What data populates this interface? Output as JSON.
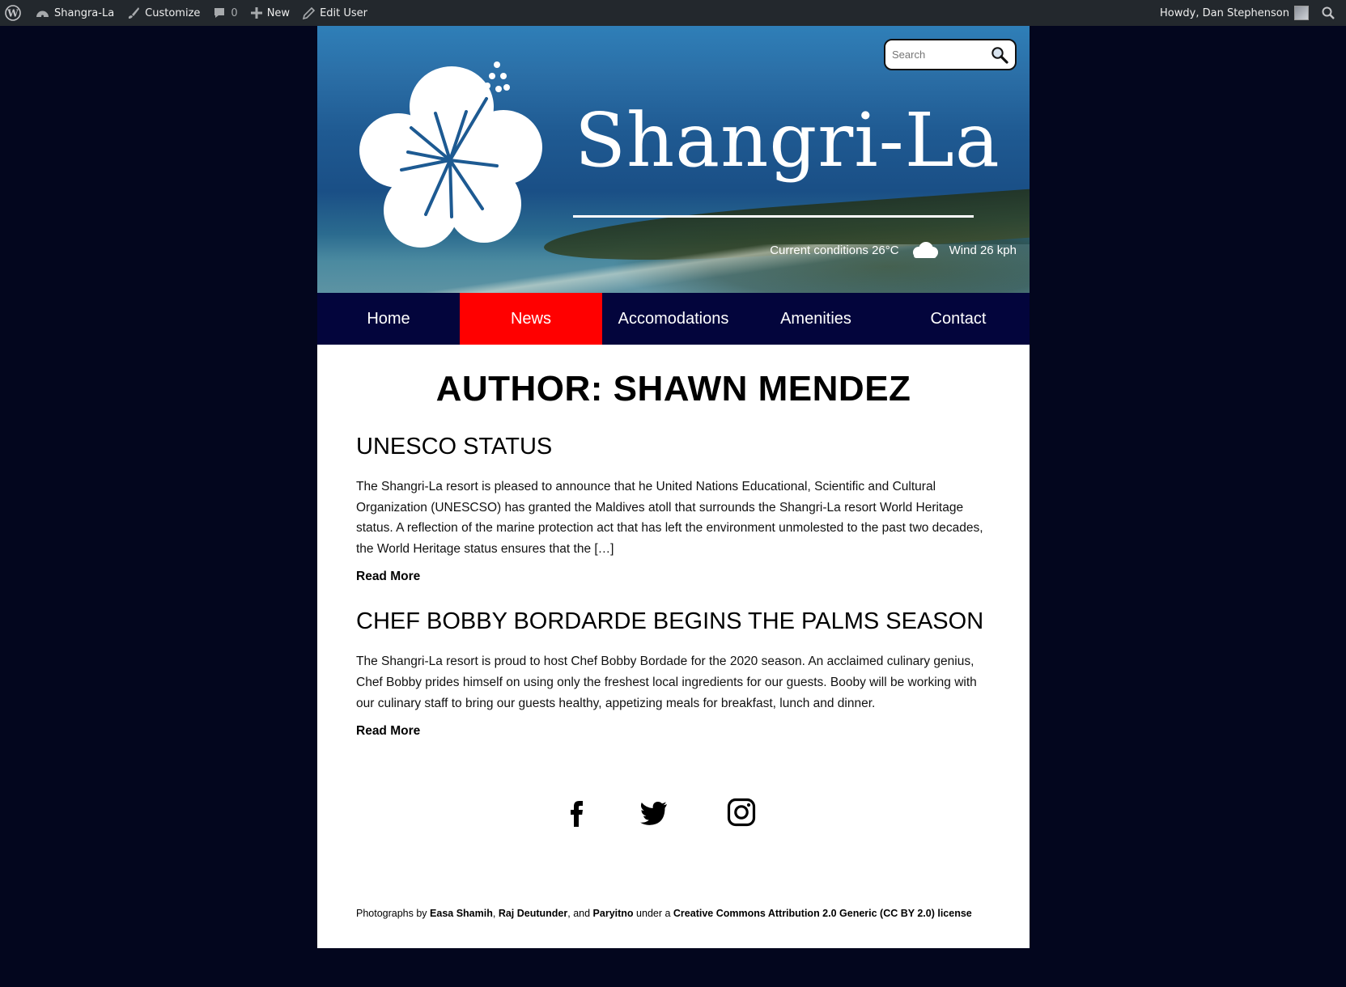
{
  "admin_bar": {
    "site_name": "Shangra-La",
    "customize": "Customize",
    "comments_count": "0",
    "new_label": "New",
    "edit_user": "Edit User",
    "howdy": "Howdy, Dan Stephenson"
  },
  "header": {
    "search_placeholder": "Search",
    "site_title": "Shangri-La",
    "conditions": "Current conditions 26°C",
    "wind": "Wind 26 kph"
  },
  "nav": {
    "items": [
      {
        "label": "Home"
      },
      {
        "label": "News",
        "active": true
      },
      {
        "label": "Accomodations"
      },
      {
        "label": "Amenities"
      },
      {
        "label": "Contact"
      }
    ],
    "active_color": "#ff0000"
  },
  "archive_title": "AUTHOR: SHAWN MENDEZ",
  "posts": [
    {
      "title": "UNESCO STATUS",
      "excerpt": "The Shangri-La resort is pleased to announce that he United Nations Educational, Scientific and Cultural Organization (UNESCSO) has granted the Maldives atoll that surrounds the Shangri-La resort World Heritage status. A reflection of the marine protection act that has left the environment unmolested to the past two decades, the World Heritage status ensures that the […]",
      "read_more": "Read More"
    },
    {
      "title": "CHEF BOBBY BORDARDE BEGINS THE PALMS SEASON",
      "excerpt": "The Shangri-La resort is proud to host Chef Bobby Bordade for the 2020 season. An acclaimed culinary genius, Chef Bobby prides himself on using only the freshest local ingredients for our guests. Booby will be working with our culinary staff to bring our guests healthy, appetizing meals for breakfast, lunch and dinner.",
      "read_more": "Read More"
    }
  ],
  "credits": {
    "prefix": "Photographs by ",
    "name1": "Easa Shamih",
    "sep1": ", ",
    "name2": "Raj Deutunder",
    "sep2": ", and ",
    "name3": "Paryitno",
    "mid": " under a ",
    "license": "Creative Commons Attribution 2.0 Generic (CC BY 2.0) license"
  },
  "social_icons": [
    "facebook-icon",
    "twitter-icon",
    "instagram-icon"
  ]
}
